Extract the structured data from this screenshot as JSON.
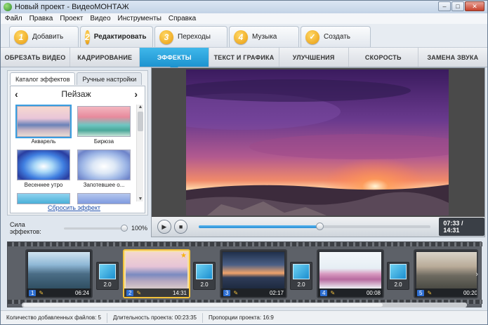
{
  "window": {
    "title": "Новый проект - ВидеоМОНТАЖ"
  },
  "menu": [
    "Файл",
    "Правка",
    "Проект",
    "Видео",
    "Инструменты",
    "Справка"
  ],
  "steps": [
    {
      "num": "1",
      "label": "Добавить"
    },
    {
      "num": "2",
      "label": "Редактировать",
      "active": true
    },
    {
      "num": "3",
      "label": "Переходы"
    },
    {
      "num": "4",
      "label": "Музыка"
    },
    {
      "num": "✓",
      "label": "Создать"
    }
  ],
  "subtabs": [
    "ОБРЕЗАТЬ ВИДЕО",
    "КАДРИРОВАНИЕ",
    "ЭФФЕКТЫ",
    "ТЕКСТ И ГРАФИКА",
    "УЛУЧШЕНИЯ",
    "СКОРОСТЬ",
    "ЗАМЕНА ЗВУКА"
  ],
  "active_subtab": "ЭФФЕКТЫ",
  "effects_panel": {
    "tabs": [
      "Каталог эффектов",
      "Ручные настройки"
    ],
    "category": "Пейзаж",
    "items": [
      "Акварель",
      "Бирюза",
      "Весеннее утро",
      "Запотевшее о..."
    ],
    "selected": "Акварель",
    "reset_label": "Сбросить эффект"
  },
  "strength": {
    "label": "Сила эффектов:",
    "value": "100%",
    "level": 1.0
  },
  "player": {
    "timecode": "07:33 / 14:31",
    "progress": 0.52
  },
  "timeline": {
    "clips": [
      {
        "num": "1",
        "duration": "06:24"
      },
      {
        "num": "2",
        "duration": "14:31",
        "selected": true
      },
      {
        "num": "3",
        "duration": "02:17"
      },
      {
        "num": "4",
        "duration": "00:08"
      },
      {
        "num": "5",
        "duration": "00:20"
      }
    ],
    "transitions": [
      "2.0",
      "2.0",
      "2.0",
      "2.0",
      "2.0"
    ]
  },
  "status": {
    "files": "Количество добавленных файлов: 5",
    "duration": "Длительность проекта: 00:23:35",
    "ratio": "Пропорции проекта: 16:9"
  }
}
